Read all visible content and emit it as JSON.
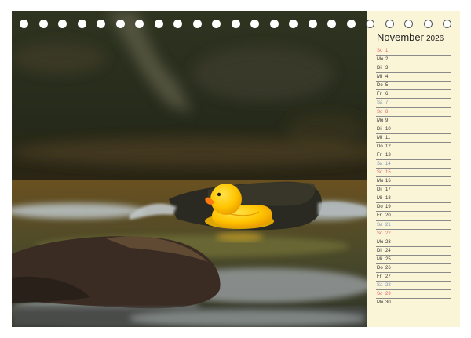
{
  "calendar": {
    "month": "November",
    "year": "2026",
    "days": [
      {
        "wd": "So",
        "d": "1",
        "type": "sunday"
      },
      {
        "wd": "Mo",
        "d": "2",
        "type": "weekday"
      },
      {
        "wd": "Di",
        "d": "3",
        "type": "weekday"
      },
      {
        "wd": "Mi",
        "d": "4",
        "type": "weekday"
      },
      {
        "wd": "Do",
        "d": "5",
        "type": "weekday"
      },
      {
        "wd": "Fr",
        "d": "6",
        "type": "weekday"
      },
      {
        "wd": "Sa",
        "d": "7",
        "type": "saturday"
      },
      {
        "wd": "So",
        "d": "8",
        "type": "sunday"
      },
      {
        "wd": "Mo",
        "d": "9",
        "type": "weekday"
      },
      {
        "wd": "Di",
        "d": "10",
        "type": "weekday"
      },
      {
        "wd": "Mi",
        "d": "11",
        "type": "weekday"
      },
      {
        "wd": "Do",
        "d": "12",
        "type": "weekday"
      },
      {
        "wd": "Fr",
        "d": "13",
        "type": "weekday"
      },
      {
        "wd": "Sa",
        "d": "14",
        "type": "saturday"
      },
      {
        "wd": "So",
        "d": "15",
        "type": "sunday"
      },
      {
        "wd": "Mo",
        "d": "16",
        "type": "weekday"
      },
      {
        "wd": "Di",
        "d": "17",
        "type": "weekday"
      },
      {
        "wd": "Mi",
        "d": "18",
        "type": "weekday"
      },
      {
        "wd": "Do",
        "d": "19",
        "type": "weekday"
      },
      {
        "wd": "Fr",
        "d": "20",
        "type": "weekday"
      },
      {
        "wd": "Sa",
        "d": "21",
        "type": "saturday"
      },
      {
        "wd": "So",
        "d": "22",
        "type": "sunday"
      },
      {
        "wd": "Mo",
        "d": "23",
        "type": "weekday"
      },
      {
        "wd": "Di",
        "d": "24",
        "type": "weekday"
      },
      {
        "wd": "Mi",
        "d": "25",
        "type": "weekday"
      },
      {
        "wd": "Do",
        "d": "26",
        "type": "weekday"
      },
      {
        "wd": "Fr",
        "d": "27",
        "type": "weekday"
      },
      {
        "wd": "Sa",
        "d": "28",
        "type": "saturday"
      },
      {
        "wd": "So",
        "d": "29",
        "type": "sunday"
      },
      {
        "wd": "Mo",
        "d": "30",
        "type": "weekday"
      }
    ]
  },
  "colors": {
    "sunday": "#e06060",
    "saturday": "#7a8fb0",
    "panel": "#fbf5d8",
    "duck": "#ffc400"
  }
}
